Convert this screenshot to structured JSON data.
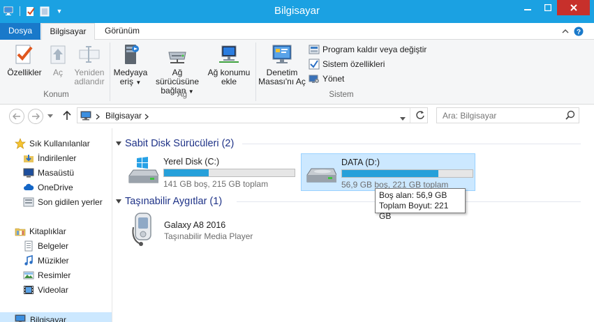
{
  "window": {
    "title": "Bilgisayar"
  },
  "tabs": {
    "file": "Dosya",
    "computer": "Bilgisayar",
    "view": "Görünüm"
  },
  "ribbon": {
    "konum": {
      "label": "Konum",
      "properties": "Özellikler",
      "open": "Aç",
      "rename_l1": "Yeniden",
      "rename_l2": "adlandır"
    },
    "ag": {
      "label": "Ağ",
      "media_l1": "Medyaya",
      "media_l2": "eriş",
      "map_l1": "Ağ sürücüsüne",
      "map_l2": "bağlan",
      "addloc_l1": "Ağ konumu",
      "addloc_l2": "ekle"
    },
    "sistem": {
      "label": "Sistem",
      "cp_l1": "Denetim",
      "cp_l2": "Masası'nı Aç",
      "uninstall": "Program kaldır veya değiştir",
      "props": "Sistem özellikleri",
      "manage": "Yönet"
    }
  },
  "address": {
    "crumb": "Bilgisayar"
  },
  "search": {
    "placeholder": "Ara: Bilgisayar"
  },
  "sidebar": {
    "favorites": "Sık Kullanılanlar",
    "downloads": "İndirilenler",
    "desktop": "Masaüstü",
    "onedrive": "OneDrive",
    "recent": "Son gidilen yerler",
    "libraries": "Kitaplıklar",
    "documents": "Belgeler",
    "music": "Müzikler",
    "pictures": "Resimler",
    "videos": "Videolar",
    "computer": "Bilgisayar"
  },
  "groups": {
    "hdd": "Sabit Disk Sürücüleri (2)",
    "removable": "Taşınabilir Aygıtlar (1)"
  },
  "drives": [
    {
      "name": "Yerel Disk (C:)",
      "info": "141 GB boş, 215 GB toplam",
      "used_fraction": 0.34
    },
    {
      "name": "DATA (D:)",
      "info": "56,9 GB boş, 221 GB toplam",
      "used_fraction": 0.74
    }
  ],
  "tooltip": {
    "line1": "Boş alan: 56,9 GB",
    "line2": "Toplam Boyut: 221 GB"
  },
  "device": {
    "name": "Galaxy A8 2016",
    "type": "Taşınabilir Media Player"
  },
  "colors": {
    "titlebar": "#1ba1e2",
    "file_tab": "#1979ca",
    "close": "#c7302b",
    "bar_fill": "#26a0da",
    "selection": "#cce8ff"
  }
}
